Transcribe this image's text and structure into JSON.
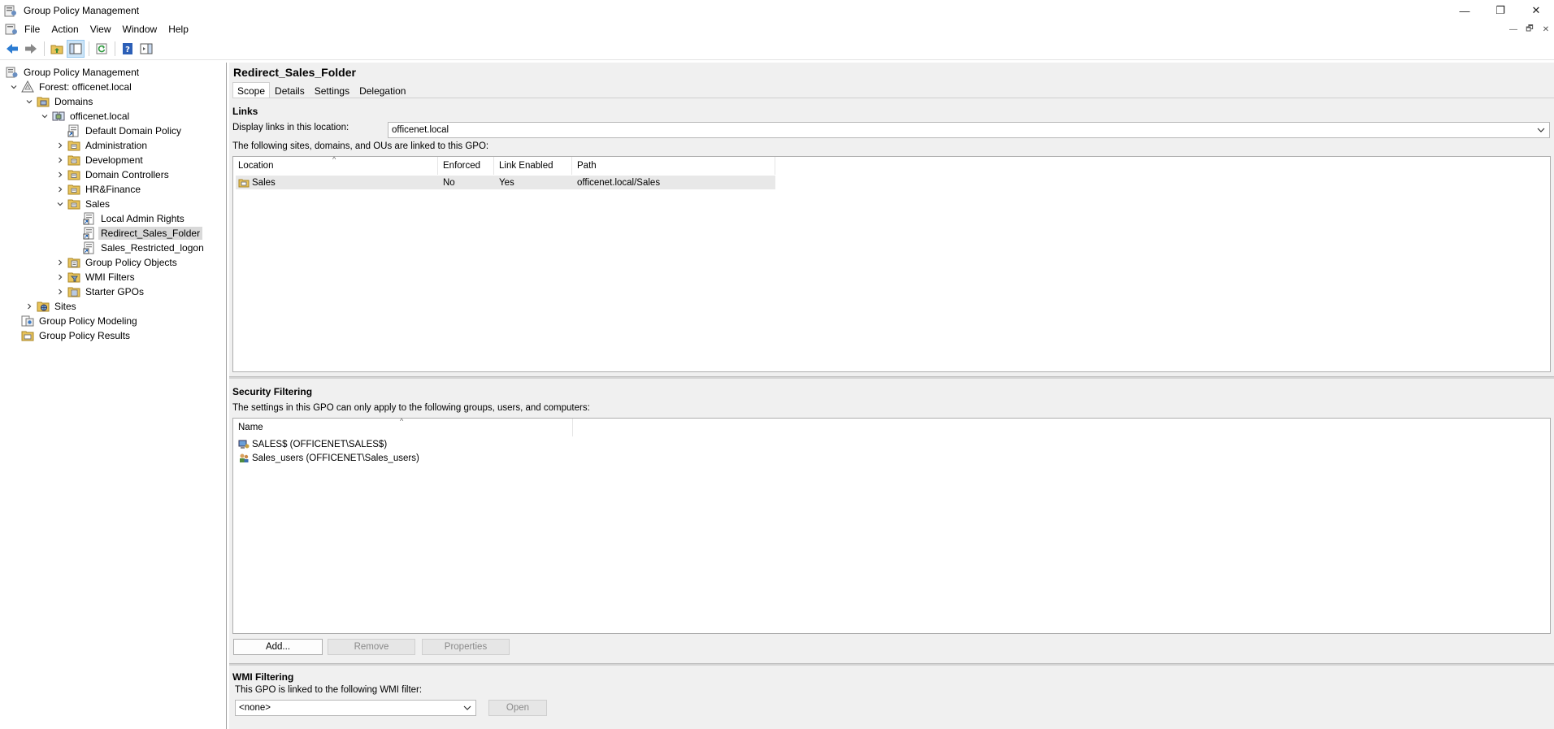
{
  "window": {
    "title": "Group Policy Management",
    "controls": {
      "minimize": "—",
      "restore": "❐",
      "close": "✕"
    }
  },
  "menu": [
    "File",
    "Action",
    "View",
    "Window",
    "Help"
  ],
  "mdi_controls": [
    "—",
    "🗗",
    "✕"
  ],
  "tree": [
    {
      "label": "Group Policy Management",
      "level": 0,
      "expander": "",
      "icon": "gpm-icon"
    },
    {
      "label": "Forest: officenet.local",
      "level": 1,
      "expander": "open",
      "icon": "forest-icon"
    },
    {
      "label": "Domains",
      "level": 2,
      "expander": "open",
      "icon": "domains-folder-icon"
    },
    {
      "label": "officenet.local",
      "level": 3,
      "expander": "open",
      "icon": "domain-icon"
    },
    {
      "label": "Default Domain Policy",
      "level": 4,
      "expander": "",
      "icon": "gpo-link-icon"
    },
    {
      "label": "Administration",
      "level": 4,
      "expander": "closed",
      "icon": "ou-folder-icon"
    },
    {
      "label": "Development",
      "level": 4,
      "expander": "closed",
      "icon": "ou-folder-icon"
    },
    {
      "label": "Domain Controllers",
      "level": 4,
      "expander": "closed",
      "icon": "ou-folder-icon"
    },
    {
      "label": "HR&Finance",
      "level": 4,
      "expander": "closed",
      "icon": "ou-folder-icon"
    },
    {
      "label": "Sales",
      "level": 4,
      "expander": "open",
      "icon": "ou-folder-icon"
    },
    {
      "label": "Local Admin Rights",
      "level": 5,
      "expander": "",
      "icon": "gpo-link-icon"
    },
    {
      "label": "Redirect_Sales_Folder",
      "level": 5,
      "expander": "",
      "icon": "gpo-link-icon",
      "selected": true
    },
    {
      "label": "Sales_Restricted_logon",
      "level": 5,
      "expander": "",
      "icon": "gpo-link-icon"
    },
    {
      "label": "Group Policy Objects",
      "level": 4,
      "expander": "closed",
      "icon": "gpo-folder-icon"
    },
    {
      "label": "WMI Filters",
      "level": 4,
      "expander": "closed",
      "icon": "wmi-folder-icon"
    },
    {
      "label": "Starter GPOs",
      "level": 4,
      "expander": "closed",
      "icon": "starter-folder-icon"
    },
    {
      "label": "Sites",
      "level": 2,
      "expander": "closed",
      "icon": "sites-icon"
    },
    {
      "label": "Group Policy Modeling",
      "level": 1,
      "expander": "",
      "icon": "modeling-icon"
    },
    {
      "label": "Group Policy Results",
      "level": 1,
      "expander": "",
      "icon": "results-icon"
    }
  ],
  "detail": {
    "title": "Redirect_Sales_Folder",
    "tabs": [
      "Scope",
      "Details",
      "Settings",
      "Delegation"
    ],
    "links": {
      "heading": "Links",
      "location_label": "Display links in this location:",
      "location_value": "officenet.local",
      "desc": "The following sites, domains, and OUs are linked to this GPO:",
      "columns": [
        "Location",
        "Enforced",
        "Link Enabled",
        "Path"
      ],
      "rows": [
        {
          "location": "Sales",
          "enforced": "No",
          "link_enabled": "Yes",
          "path": "officenet.local/Sales"
        }
      ]
    },
    "security": {
      "heading": "Security Filtering",
      "desc": "The settings in this GPO can only apply to the following groups, users, and computers:",
      "columns": [
        "Name"
      ],
      "rows": [
        {
          "name": "SALES$ (OFFICENET\\SALES$)",
          "icon": "computer-icon"
        },
        {
          "name": "Sales_users (OFFICENET\\Sales_users)",
          "icon": "group-icon"
        }
      ],
      "buttons": {
        "add": "Add...",
        "remove": "Remove",
        "properties": "Properties"
      }
    },
    "wmi": {
      "heading": "WMI Filtering",
      "desc": "This GPO is linked to the following WMI filter:",
      "value": "<none>",
      "open": "Open"
    }
  }
}
